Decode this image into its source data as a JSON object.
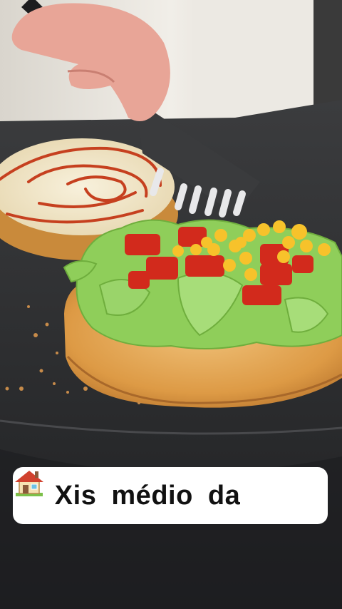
{
  "caption": {
    "text": "Xis médio da",
    "emoji_icon": "house-emoji-icon"
  },
  "scene": {
    "subject": "burger-assembly",
    "colors": {
      "counter": "#2f3032",
      "wall": "#e9e5dd",
      "bun": "#e3a453",
      "lettuce": "#8fce5a",
      "tomato": "#d22a1c",
      "corn": "#f7c22b",
      "ketchup": "#c6401f",
      "mayo": "#f3ead0"
    }
  }
}
